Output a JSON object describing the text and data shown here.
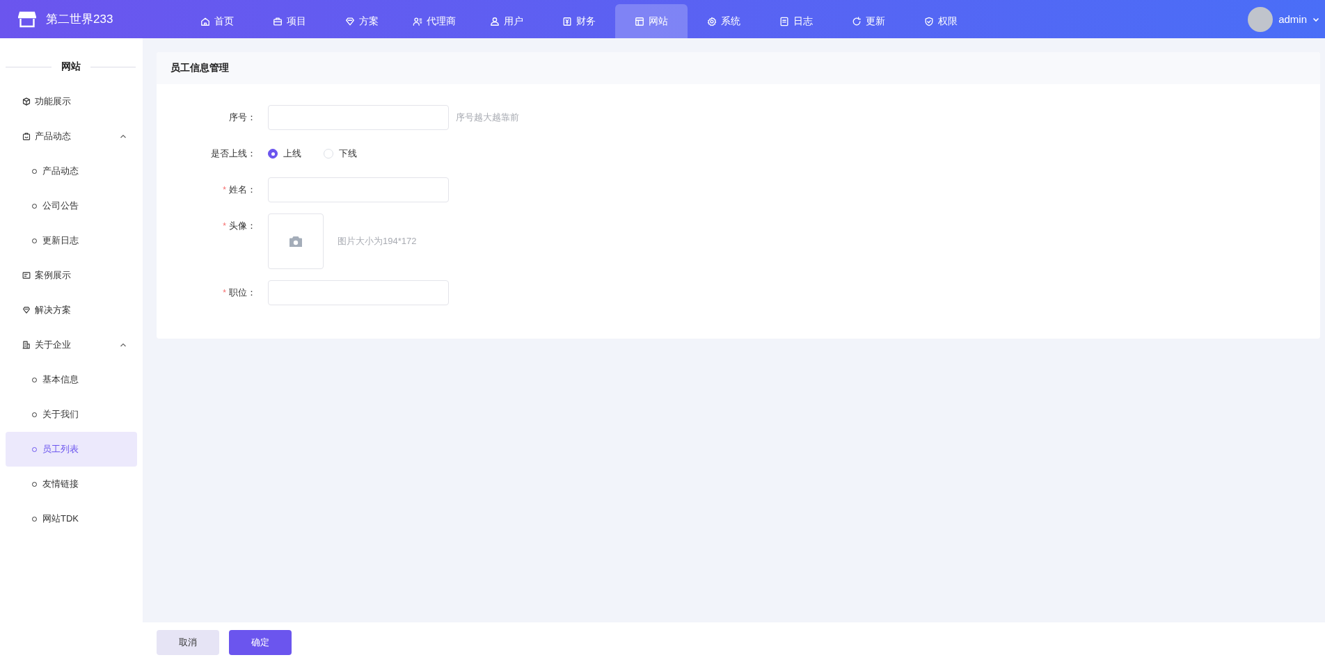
{
  "header": {
    "brand": "第二世界233",
    "nav": [
      {
        "label": "首页",
        "selected": false
      },
      {
        "label": "项目",
        "selected": false
      },
      {
        "label": "方案",
        "selected": false
      },
      {
        "label": "代理商",
        "selected": false
      },
      {
        "label": "用户",
        "selected": false
      },
      {
        "label": "财务",
        "selected": false
      },
      {
        "label": "网站",
        "selected": true
      },
      {
        "label": "系统",
        "selected": false
      },
      {
        "label": "日志",
        "selected": false
      },
      {
        "label": "更新",
        "selected": false
      },
      {
        "label": "权限",
        "selected": false
      }
    ],
    "user": {
      "name": "admin"
    }
  },
  "sidebar": {
    "title": "网站",
    "items": [
      {
        "label": "功能展示",
        "selected": false
      },
      {
        "label": "产品动态",
        "expanded": true,
        "children": [
          {
            "label": "产品动态",
            "selected": false
          },
          {
            "label": "公司公告",
            "selected": false
          },
          {
            "label": "更新日志",
            "selected": false
          }
        ]
      },
      {
        "label": "案例展示",
        "selected": false
      },
      {
        "label": "解决方案",
        "selected": false
      },
      {
        "label": "关于企业",
        "expanded": true,
        "children": [
          {
            "label": "基本信息",
            "selected": false
          },
          {
            "label": "关于我们",
            "selected": false
          },
          {
            "label": "员工列表",
            "selected": true
          },
          {
            "label": "友情链接",
            "selected": false
          },
          {
            "label": "网站TDK",
            "selected": false
          }
        ]
      }
    ]
  },
  "card": {
    "title": "员工信息管理",
    "fields": [
      {
        "kind": "text",
        "label": "序号：",
        "hint": "序号越大越靠前"
      },
      {
        "kind": "radio",
        "label": "是否上线：",
        "options": [
          {
            "label": "上线",
            "selected": true
          },
          {
            "label": "下线",
            "selected": false
          }
        ]
      },
      {
        "kind": "text",
        "label": "姓名：",
        "marker": "*"
      },
      {
        "kind": "upload",
        "label": "头像：",
        "marker": "*",
        "hint": "图片大小为194*172"
      },
      {
        "kind": "text",
        "label": "职位：",
        "marker": "*"
      }
    ]
  },
  "footer": {
    "buttons": [
      {
        "label": "取消",
        "kind": "secondary"
      },
      {
        "label": "确定",
        "kind": "primary"
      }
    ]
  }
}
